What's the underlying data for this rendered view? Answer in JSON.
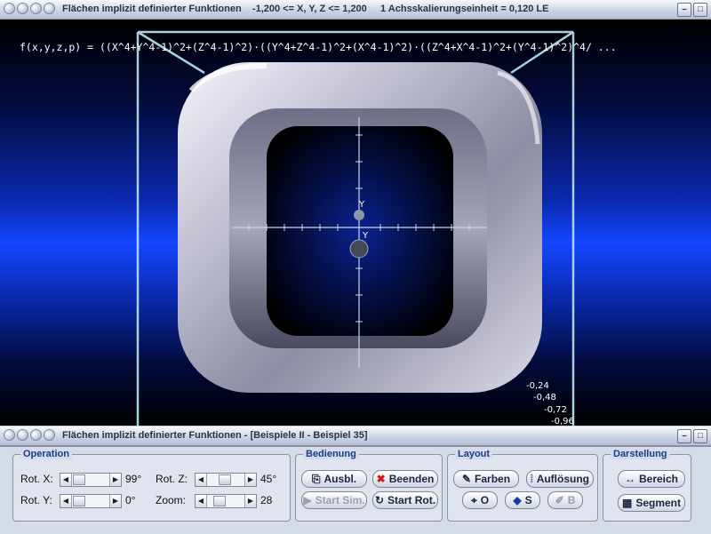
{
  "top_window": {
    "title": "Flächen implizit definierter Funktionen    -1,200 <= X, Y, Z <= 1,200     1 Achsskalierungseinheit = 0,120 LE"
  },
  "viewport": {
    "formula": "f(x,y,z,p) = ((X^4+Y^4-1)^2+(Z^4-1)^2)·((Y^4+Z^4-1)^2+(X^4-1)^2)·((Z^4+X^4-1)^2+(Y^4-1)^2)^4/ ...",
    "axis_y_label_top": "Y",
    "axis_y_label_mid": "Y",
    "tick_labels": [
      "-0,24",
      "-0,48",
      "-0,72",
      "-0,96"
    ]
  },
  "bottom_window": {
    "title": "Flächen implizit definierter Funktionen - [Beispiele II - Beispiel 35]"
  },
  "operation": {
    "title": "Operation",
    "rot_x_label": "Rot. X:",
    "rot_x_value": "99°",
    "rot_y_label": "Rot. Y:",
    "rot_y_value": "0°",
    "rot_z_label": "Rot. Z:",
    "rot_z_value": "45°",
    "zoom_label": "Zoom:",
    "zoom_value": "28"
  },
  "bedienung": {
    "title": "Bedienung",
    "ausbl": "Ausbl.",
    "beenden": "Beenden",
    "start_sim": "Start Sim.",
    "start_rot": "Start Rot."
  },
  "layout": {
    "title": "Layout",
    "farben": "Farben",
    "aufloesung": "Auflösung",
    "o": "O",
    "s": "S",
    "b": "B"
  },
  "darstellung": {
    "title": "Darstellung",
    "bereich": "Bereich",
    "segment": "Segment"
  }
}
